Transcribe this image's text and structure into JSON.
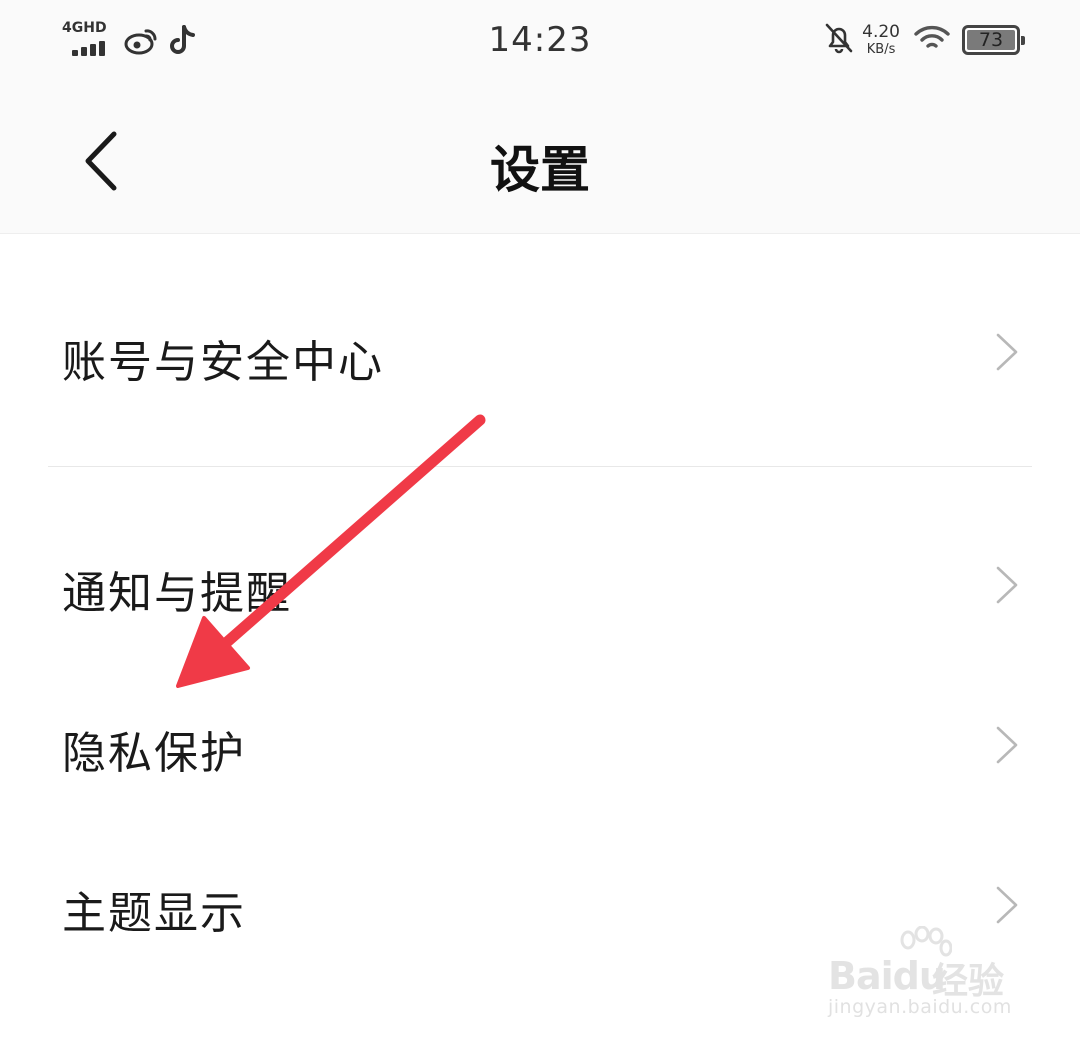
{
  "status_bar": {
    "network_type": "4GHD",
    "time": "14:23",
    "net_speed_value": "4.20",
    "net_speed_unit": "KB/s",
    "battery_level": "73",
    "icons": [
      "signal-icon",
      "weibo-icon",
      "tiktok-icon",
      "bell-off-icon",
      "wifi-icon",
      "battery-icon"
    ]
  },
  "nav": {
    "title": "设置",
    "back_icon": "chevron-left-icon"
  },
  "settings": {
    "items": [
      {
        "label": "账号与安全中心"
      },
      {
        "label": "通知与提醒"
      },
      {
        "label": "隐私保护"
      },
      {
        "label": "主题显示"
      }
    ]
  },
  "watermark": {
    "brand": "Baidu",
    "brand_cn": "经验",
    "url": "jingyan.baidu.com"
  },
  "colors": {
    "arrow": "#f03a47",
    "background": "#ffffff",
    "header_background": "#fafafa",
    "chevron": "#b8b8b8"
  }
}
